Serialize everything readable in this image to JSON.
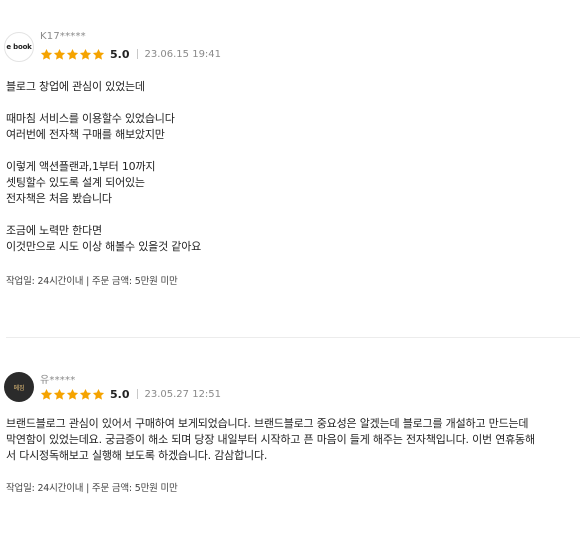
{
  "reviews": [
    {
      "avatar_text": "e book",
      "username": "K17*****",
      "score": "5.0",
      "date": "23.06.15 19:41",
      "paragraphs": [
        [
          "블로그 창업에 관심이 있었는데"
        ],
        [
          "때마침 서비스를 이용할수 있었습니다",
          "여러번에 전자책 구매를 해보았지만"
        ],
        [
          "이렇게 액션플랜과,1부터 10까지",
          "셋팅할수 있도록 설계 되어있는",
          "전자책은 처음 봤습니다"
        ],
        [
          "조금에 노력만 한다면",
          "이것만으로 시도 이상 해볼수 있을것 같아요"
        ]
      ],
      "meta": "작업일: 24시간이내 | 주문 금액: 5만원 미만"
    },
    {
      "avatar_text": "메짐",
      "username": "유*****",
      "score": "5.0",
      "date": "23.05.27 12:51",
      "lines": [
        "브랜드블로그 관심이 있어서 구매하여 보게되었습니다. 브랜드블로그 중요성은 알겠는데 블로그를 개설하고 만드는데",
        "막연함이 있었는데요. 궁금증이 해소 되며 당장 내일부터 시작하고 픈 마음이 들게 해주는 전자책입니다. 이번 연휴동해",
        "서 다시정독해보고 실행해 보도록 하겠습니다. 감삼합니다."
      ],
      "meta": "작업일: 24시간이내 | 주문 금액: 5만원 미만"
    }
  ],
  "colors": {
    "star": "#f5a300",
    "divider": "#ececec",
    "muted": "#8a8a8a"
  },
  "icons": {
    "star": "star-icon"
  }
}
